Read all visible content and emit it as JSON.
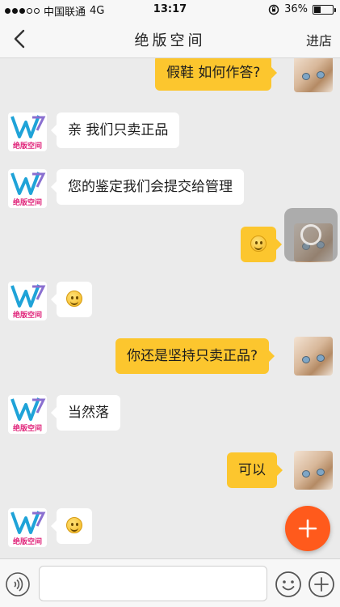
{
  "status_bar": {
    "carrier": "中国联通",
    "network": "4G",
    "time": "13:17",
    "battery": "36%",
    "battery_level": 0.36
  },
  "nav": {
    "title": "绝版空间",
    "action_label": "进店"
  },
  "shop": {
    "logo_text": "绝版空间"
  },
  "messages": [
    {
      "from": "user",
      "type": "text",
      "text": "假鞋 如何作答?"
    },
    {
      "from": "shop",
      "type": "text",
      "text": "亲  我们只卖正品"
    },
    {
      "from": "shop",
      "type": "text",
      "text": "您的鉴定我们会提交给管理"
    },
    {
      "from": "user",
      "type": "emoji",
      "emoji": "smile"
    },
    {
      "from": "shop",
      "type": "emoji",
      "emoji": "smile"
    },
    {
      "from": "user",
      "type": "text",
      "text": "你还是坚持只卖正品?"
    },
    {
      "from": "shop",
      "type": "text",
      "text": "当然落"
    },
    {
      "from": "user",
      "type": "text",
      "text": "可以"
    },
    {
      "from": "shop",
      "type": "emoji",
      "emoji": "smile"
    }
  ],
  "input": {
    "value": "",
    "placeholder": ""
  },
  "colors": {
    "user_bubble": "#fcc62e",
    "shop_bubble": "#ffffff",
    "chat_background": "#ebebeb",
    "fab": "#ff5a1c"
  },
  "icons": {
    "back": "chevron-left-icon",
    "voice": "voice-icon",
    "emoji": "smiley-face-icon",
    "more": "plus-circle-icon",
    "fab": "plus-icon"
  }
}
